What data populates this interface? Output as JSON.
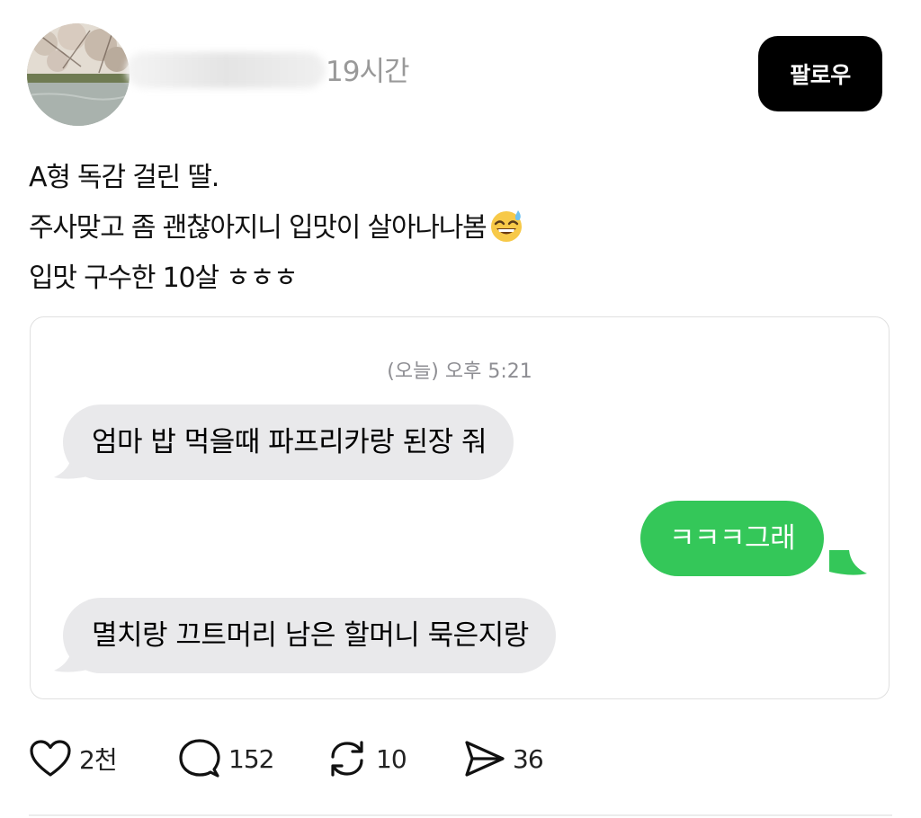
{
  "post": {
    "time": "19시간",
    "follow_label": "팔로우",
    "text_lines": [
      "A형 독감 걸린 딸.",
      "주사맞고 좀 괜찮아지니 입맛이 살아나나봄",
      "입맛 구수한 10살 ㅎㅎㅎ"
    ],
    "emoji": "grinning-face-with-sweat"
  },
  "chat": {
    "timestamp": "(오늘) 오후 5:21",
    "messages": [
      {
        "side": "received",
        "text": "엄마 밥 먹을때 파프리카랑 된장 줘"
      },
      {
        "side": "sent",
        "text": "ㅋㅋㅋ그래"
      },
      {
        "side": "received",
        "text": "멸치랑 끄트머리 남은 할머니 묵은지랑"
      }
    ]
  },
  "actions": {
    "like_count": "2천",
    "comment_count": "152",
    "repost_count": "10",
    "share_count": "36",
    "icons": [
      "heart-icon",
      "comment-icon",
      "repost-icon",
      "share-icon"
    ]
  },
  "colors": {
    "sent_bubble": "#34c759",
    "received_bubble": "#e9e9eb",
    "follow_button": "#000000"
  }
}
